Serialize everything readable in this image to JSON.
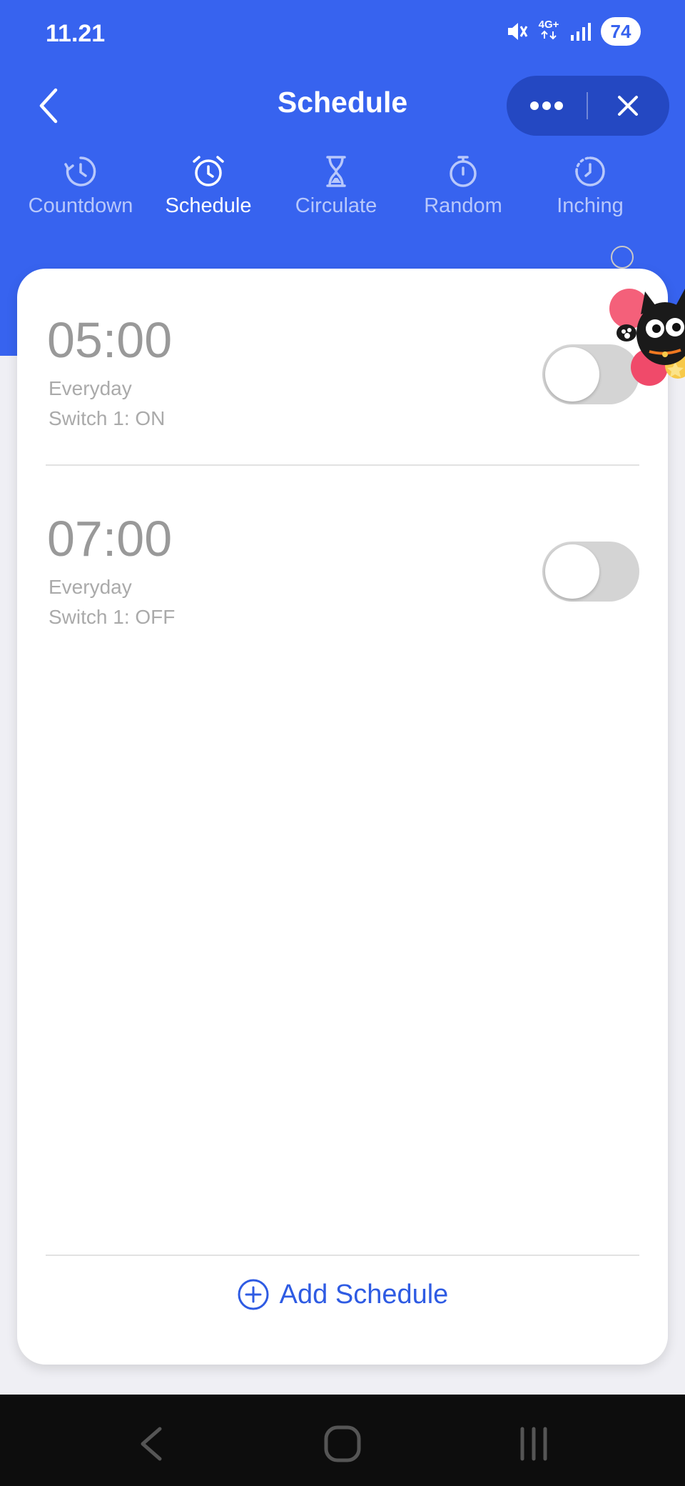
{
  "status_bar": {
    "time": "11.21",
    "network": "4G+",
    "battery": "74"
  },
  "header": {
    "title": "Schedule"
  },
  "tabs": [
    {
      "label": "Countdown",
      "icon": "countdown-icon"
    },
    {
      "label": "Schedule",
      "icon": "alarm-clock-icon",
      "active": true
    },
    {
      "label": "Circulate",
      "icon": "hourglass-icon"
    },
    {
      "label": "Random",
      "icon": "stopwatch-icon"
    },
    {
      "label": "Inching",
      "icon": "dotted-clock-icon"
    }
  ],
  "schedules": [
    {
      "time": "05:00",
      "repeat": "Everyday",
      "action": "Switch 1: ON",
      "enabled": false
    },
    {
      "time": "07:00",
      "repeat": "Everyday",
      "action": "Switch 1: OFF",
      "enabled": false
    }
  ],
  "add_button": {
    "label": "Add Schedule"
  },
  "colors": {
    "primary": "#3763ef",
    "capsule": "#2448c2",
    "link": "#2e5be3",
    "toggle_off": "#d4d4d4"
  }
}
